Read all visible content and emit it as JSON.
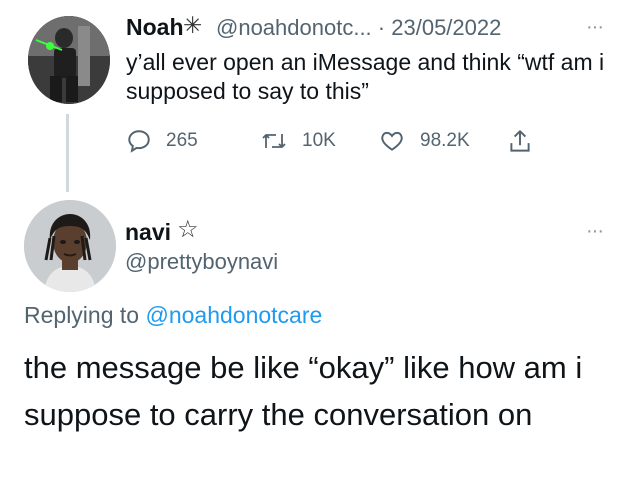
{
  "parent_tweet": {
    "display_name": "Noah",
    "name_symbol": "✳",
    "handle": "@noahdonotc...",
    "separator": "·",
    "date": "23/05/2022",
    "more": "···",
    "text": "y’all ever open an iMessage and think “wtf am i supposed to say to this”",
    "replies": "265",
    "retweets": "10K",
    "likes": "98.2K"
  },
  "reply_tweet": {
    "display_name": "navi",
    "name_symbol": "☆",
    "handle": "@prettyboynavi",
    "more": "···",
    "replying_prefix": "Replying to",
    "replying_mention": "@noahdonotcare",
    "text": "the message be like “okay” like how am i suppose to carry the conversation on"
  },
  "colors": {
    "text": "#0f1419",
    "secondary": "#536471",
    "link": "#1d9bf0",
    "thread_line": "#cfd9de"
  }
}
